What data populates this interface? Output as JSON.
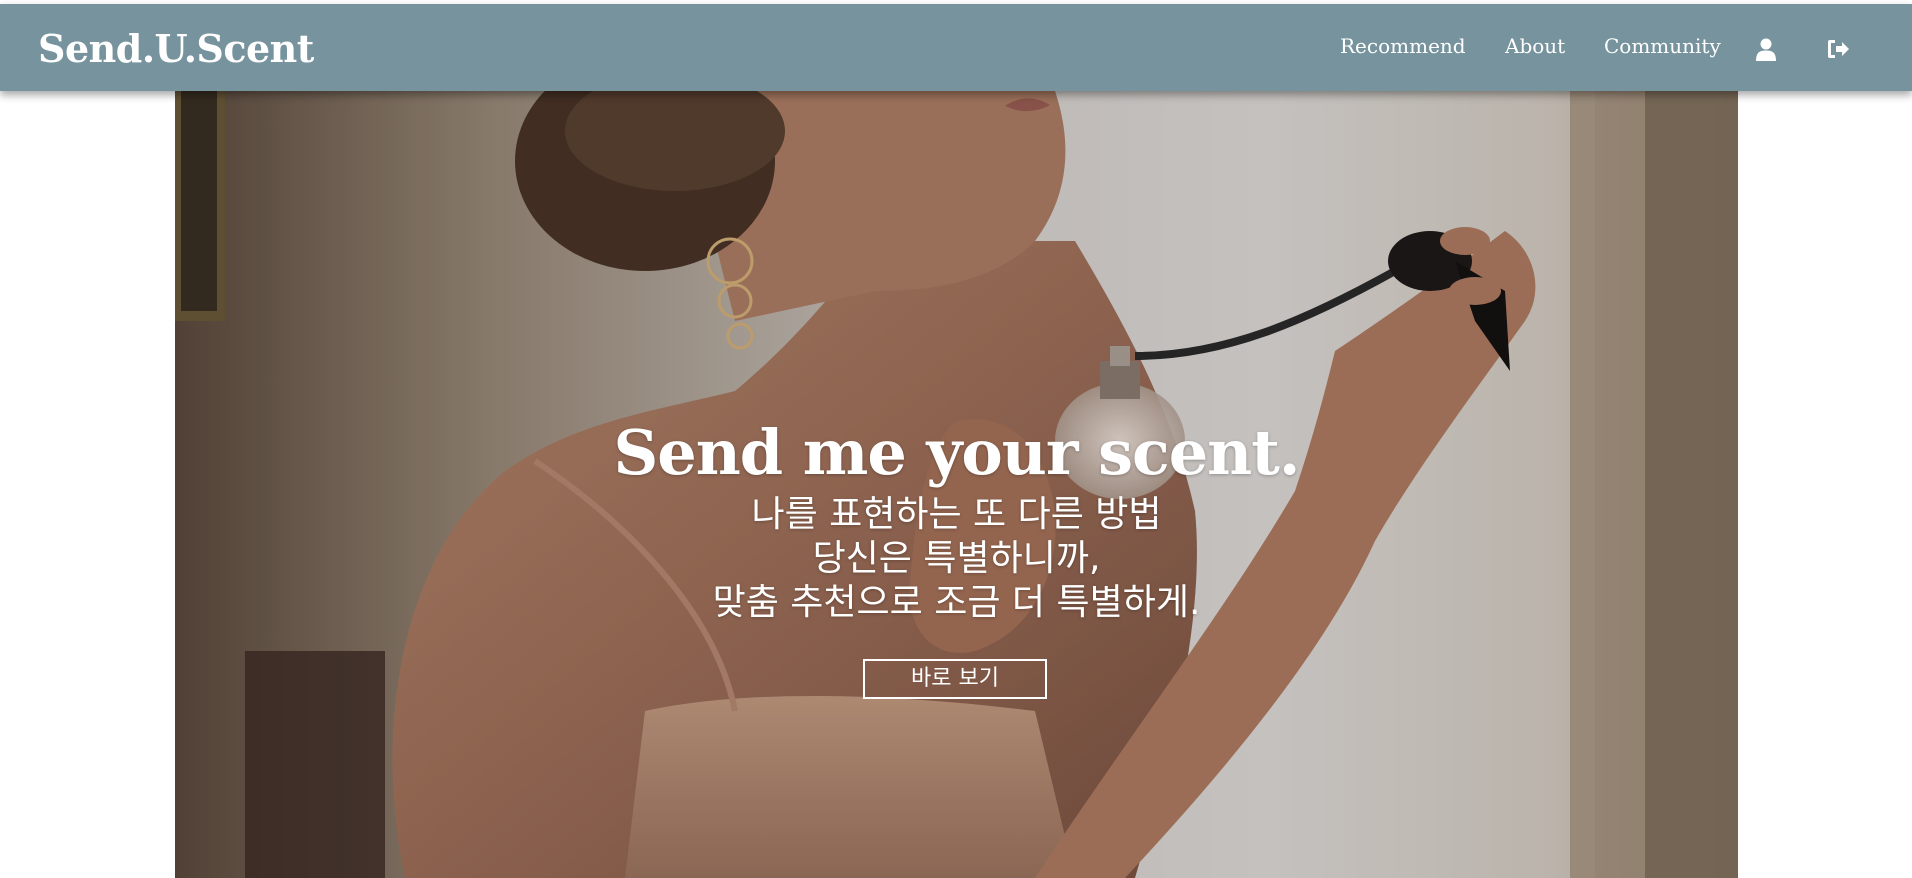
{
  "navbar": {
    "brand": "Send.U.Scent",
    "links": [
      "Recommend",
      "About",
      "Community"
    ],
    "icons": [
      "user-icon",
      "sign-out-icon"
    ],
    "background": "#77949e"
  },
  "hero": {
    "title": "Send me your scent.",
    "lines": [
      "나를 표현하는 또 다른 방법",
      "당신은 특별하니까,",
      "맞춤 추천으로 조금 더 특별하게."
    ],
    "cta_label": "바로 보기",
    "image": "woman-spraying-perfume-photo"
  }
}
